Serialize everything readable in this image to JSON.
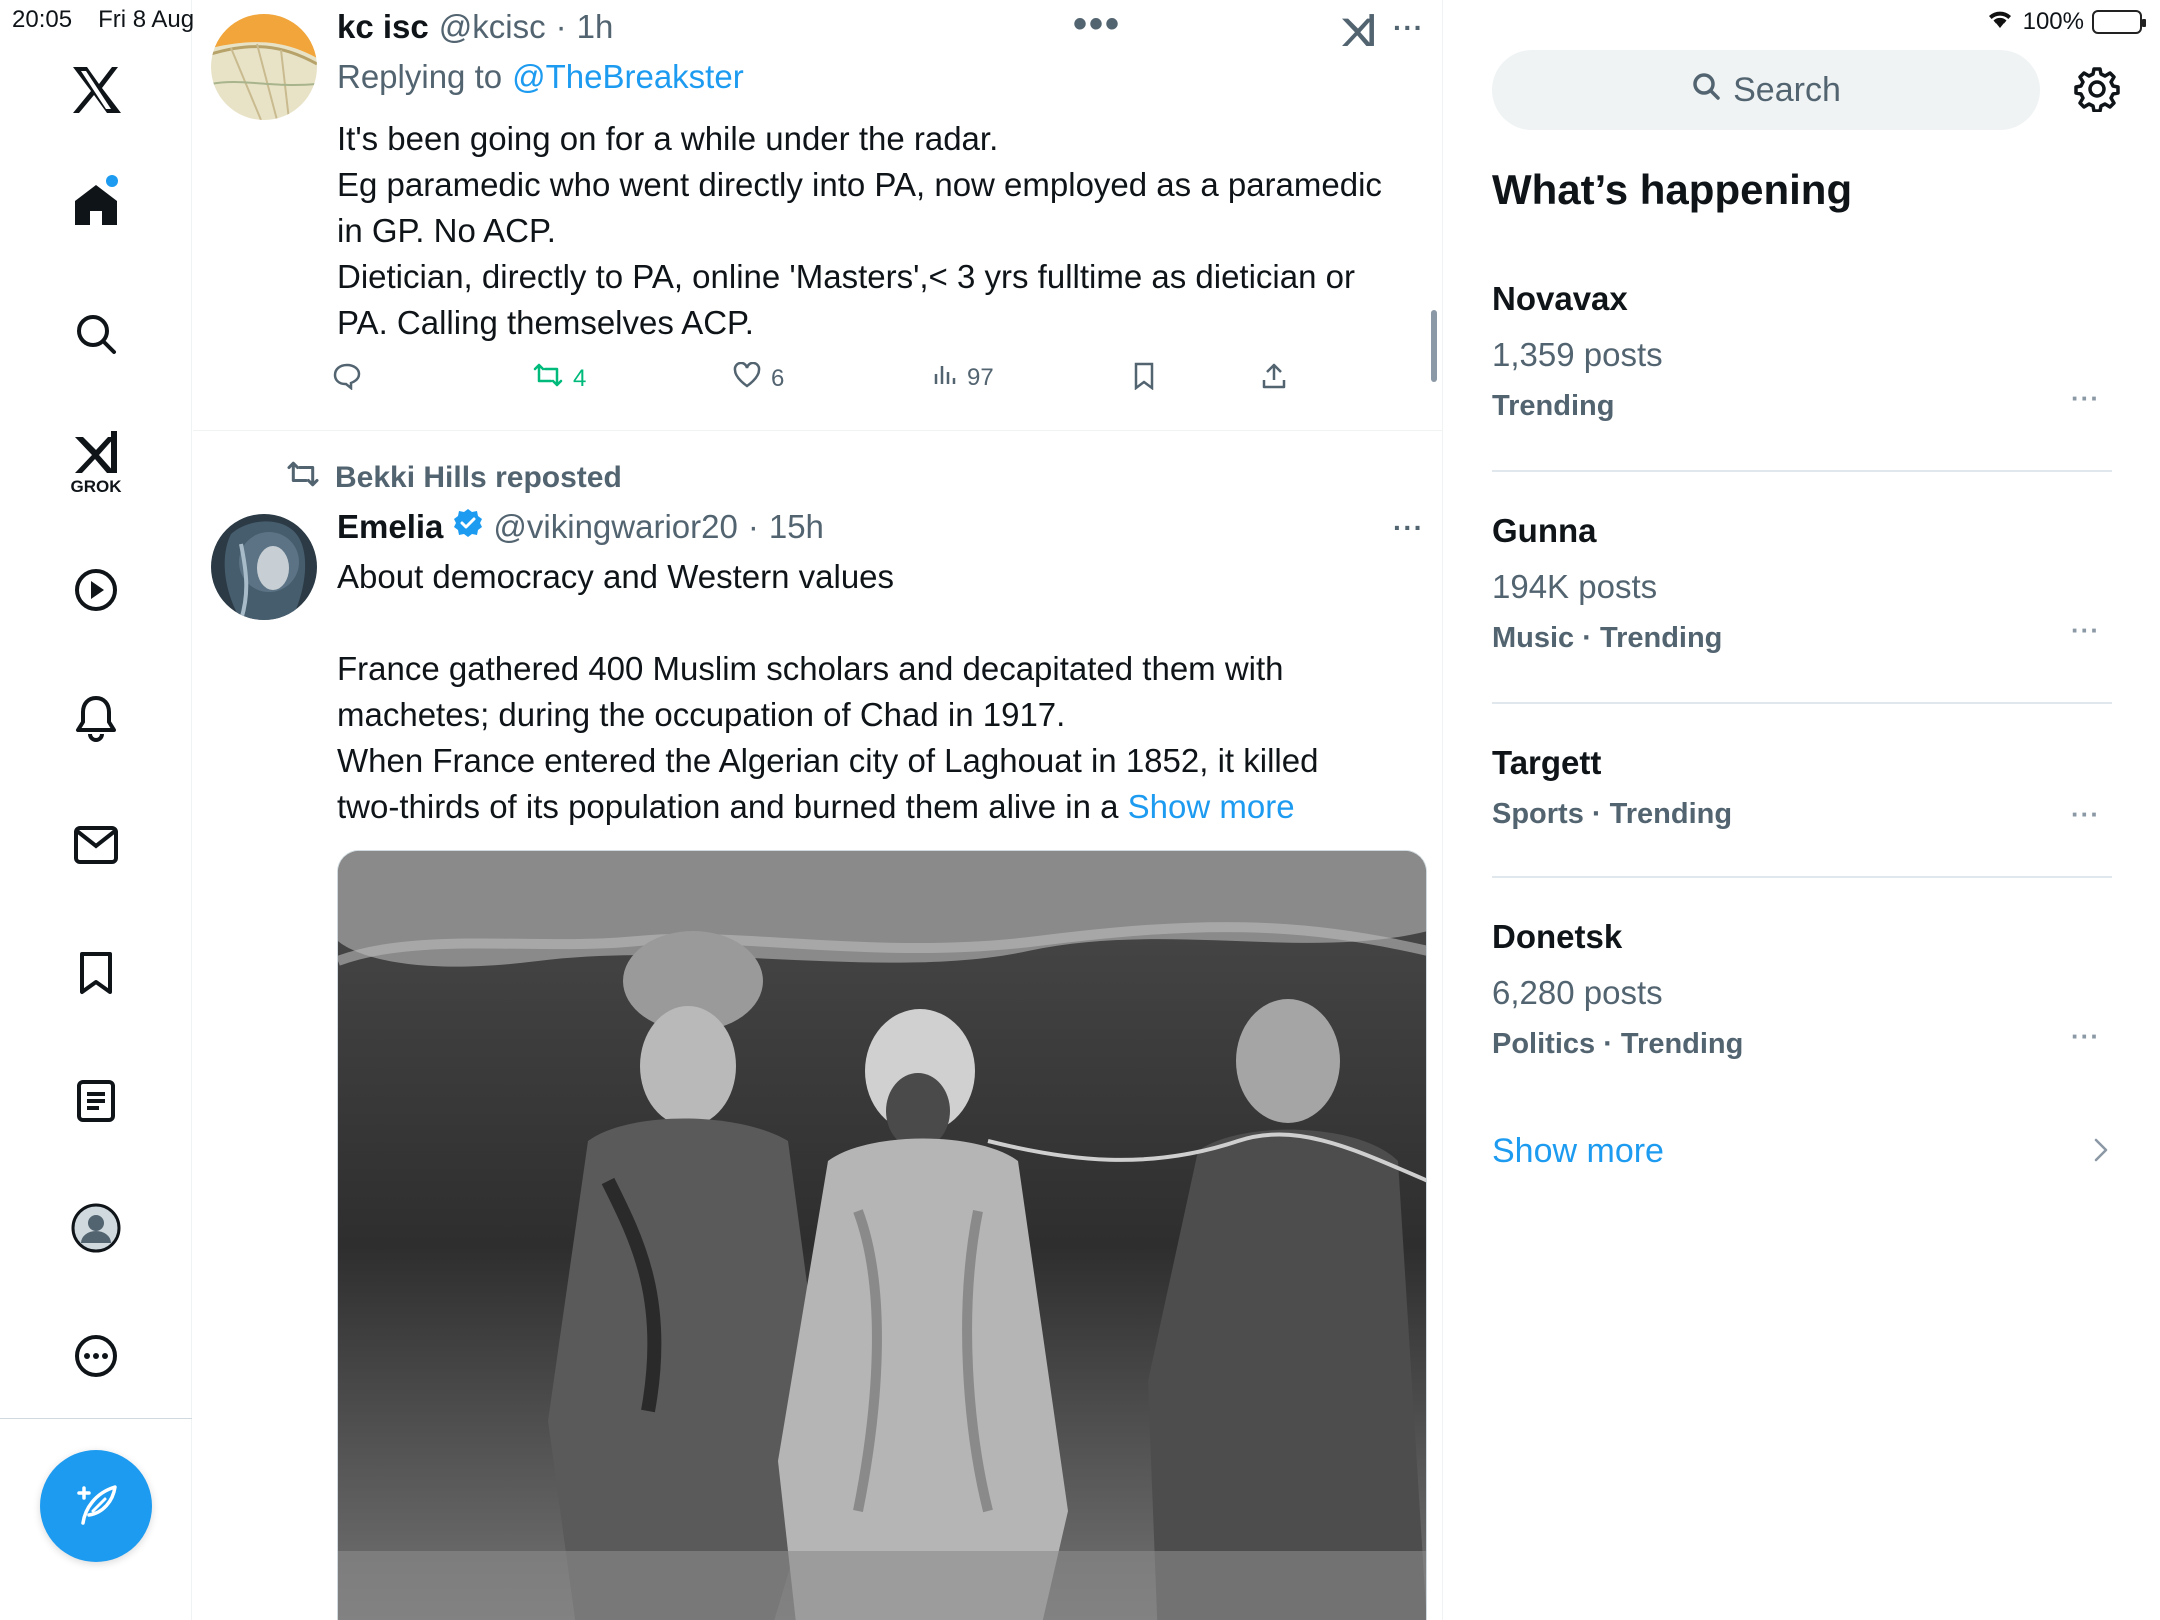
{
  "status_bar": {
    "time": "20:05",
    "date": "Fri 8 Aug",
    "battery": "100%"
  },
  "sidebar": {
    "logo": "x-logo-icon",
    "items": [
      {
        "name": "home",
        "icon": "home-icon",
        "active": true
      },
      {
        "name": "explore",
        "icon": "search-icon"
      },
      {
        "name": "grok",
        "icon": "grok-icon",
        "label": "GROK"
      },
      {
        "name": "videos",
        "icon": "play-icon"
      },
      {
        "name": "notifications",
        "icon": "bell-icon"
      },
      {
        "name": "messages",
        "icon": "mail-icon"
      },
      {
        "name": "bookmarks",
        "icon": "bookmark-icon"
      },
      {
        "name": "lists",
        "icon": "list-icon"
      },
      {
        "name": "profile",
        "icon": "profile-icon"
      },
      {
        "name": "more",
        "icon": "more-circle-icon"
      }
    ],
    "compose_icon": "compose-icon"
  },
  "feed": {
    "reply_tweet": {
      "name": "kc isc",
      "handle": "@kcisc",
      "time": "1h",
      "replying_prefix": "Replying to",
      "replying_to": "@TheBreakster",
      "lines": [
        "It's been going on for a while under the radar.",
        "Eg  paramedic who went directly into PA, now employed as a paramedic",
        "in GP.  No ACP.",
        "Dietician, directly to PA, online 'Masters',< 3 yrs fulltime as dietician or",
        "PA. Calling themselves ACP."
      ],
      "reposts": "4",
      "likes": "6",
      "views": "97"
    },
    "repost_tweet": {
      "reposted_by": "Bekki Hills reposted",
      "name": "Emelia",
      "handle": "@vikingwarior20",
      "time": "15h",
      "line1": "About democracy and Western values",
      "lines": [
        "France gathered 400 Muslim scholars and decapitated them with",
        "machetes; during the occupation of Chad in 1917.",
        "When France entered the Algerian city of Laghouat in 1852, it killed"
      ],
      "last_line": "two-thirds of its population and burned them alive in a",
      "show_more": "Show more"
    }
  },
  "right": {
    "search_placeholder": "Search",
    "section_title": "What’s happening",
    "trends": [
      {
        "name": "Novavax",
        "count": "1,359 posts",
        "context": "Trending"
      },
      {
        "name": "Gunna",
        "count": "194K posts",
        "context": "Music · Trending"
      },
      {
        "name": "Targett",
        "count": "",
        "context": "Sports · Trending"
      },
      {
        "name": "Donetsk",
        "count": "6,280 posts",
        "context": "Politics · Trending"
      }
    ],
    "show_more": "Show more"
  },
  "colors": {
    "accent": "#1d9bf0",
    "text": "#0f1419",
    "muted": "#536471",
    "repost_green": "#00ba7c"
  }
}
